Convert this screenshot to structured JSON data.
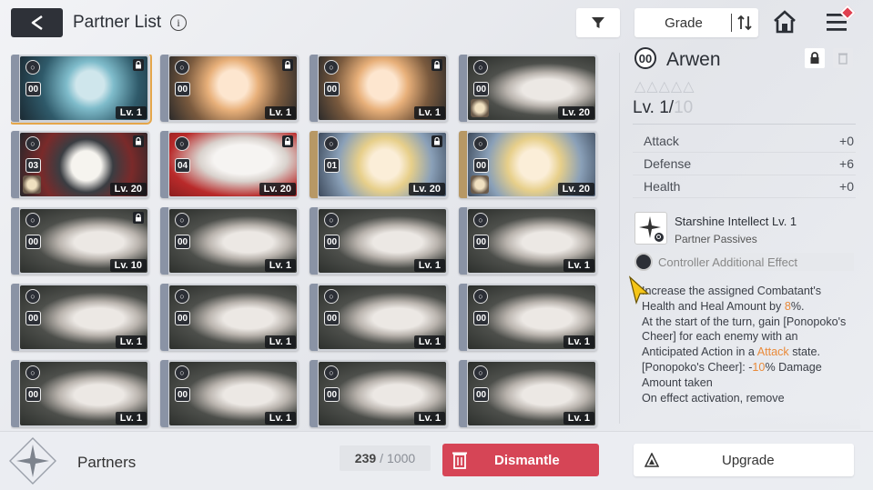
{
  "header": {
    "title": "Partner List",
    "info_glyph": "i",
    "grade_label": "Grade",
    "icons": [
      "back-arrow-icon",
      "info-icon",
      "filter-icon",
      "sort-icon",
      "home-icon",
      "menu-icon"
    ]
  },
  "partners": [
    {
      "num": "00",
      "level": "Lv. 1",
      "locked": true,
      "selected": true,
      "art": "teal"
    },
    {
      "num": "00",
      "level": "Lv. 1",
      "locked": true,
      "art": "orange"
    },
    {
      "num": "00",
      "level": "Lv. 1",
      "locked": true,
      "art": "orange"
    },
    {
      "num": "00",
      "level": "Lv. 20",
      "locked": false,
      "art": "mask",
      "mini": true
    },
    {
      "num": "03",
      "level": "Lv. 20",
      "locked": true,
      "art": "rabbit",
      "mini": true
    },
    {
      "num": "04",
      "level": "Lv. 20",
      "locked": true,
      "art": "white"
    },
    {
      "num": "01",
      "level": "Lv. 20",
      "locked": true,
      "art": "blonde",
      "gold": true
    },
    {
      "num": "00",
      "level": "Lv. 20",
      "locked": false,
      "art": "blonde",
      "gold": true,
      "mini": true
    },
    {
      "num": "00",
      "level": "Lv. 10",
      "locked": true,
      "art": "mask"
    },
    {
      "num": "00",
      "level": "Lv. 1",
      "locked": false,
      "art": "mask"
    },
    {
      "num": "00",
      "level": "Lv. 1",
      "locked": false,
      "art": "mask"
    },
    {
      "num": "00",
      "level": "Lv. 1",
      "locked": false,
      "art": "mask"
    },
    {
      "num": "00",
      "level": "Lv. 1",
      "locked": false,
      "art": "mask"
    },
    {
      "num": "00",
      "level": "Lv. 1",
      "locked": false,
      "art": "mask"
    },
    {
      "num": "00",
      "level": "Lv. 1",
      "locked": false,
      "art": "mask"
    },
    {
      "num": "00",
      "level": "Lv. 1",
      "locked": false,
      "art": "mask"
    },
    {
      "num": "00",
      "level": "Lv. 1",
      "locked": false,
      "art": "mask"
    },
    {
      "num": "00",
      "level": "Lv. 1",
      "locked": false,
      "art": "mask"
    },
    {
      "num": "00",
      "level": "Lv. 1",
      "locked": false,
      "art": "mask"
    },
    {
      "num": "00",
      "level": "Lv. 1",
      "locked": false,
      "art": "mask"
    }
  ],
  "detail": {
    "num": "00",
    "name": "Arwen",
    "stars": "△△△△△",
    "level_current": "Lv. 1/",
    "level_max": "10",
    "stats": [
      {
        "label": "Attack",
        "value": "+0"
      },
      {
        "label": "Defense",
        "value": "+6"
      },
      {
        "label": "Health",
        "value": "+0"
      }
    ],
    "skill_name": "Starshine Intellect Lv. 1",
    "skill_sub": "Partner Passives",
    "controller_label": "Controller Additional Effect",
    "desc": {
      "p1a": "Increase the assigned Combatant's Health and Heal Amount by ",
      "p1b": "8",
      "p1c": "%.",
      "p2a": "At the start of the turn, gain [Ponopoko's Cheer] for each enemy with an Anticipated Action in a ",
      "p2b": "Attack",
      "p2c": " state.",
      "p3a": "[Ponopoko's Cheer]: -",
      "p3b": "10",
      "p3c": "% Damage Amount taken",
      "p4": "On effect activation, remove"
    }
  },
  "bottom": {
    "partners_label": "Partners",
    "count_current": "239",
    "count_sep": "/",
    "count_max": "1000",
    "dismantle_label": "Dismantle",
    "upgrade_label": "Upgrade"
  },
  "colors": {
    "accent_red": "#d64556",
    "highlight": "#e98a3a",
    "selected_border": "#e5a64a",
    "dark": "#2c2f36"
  }
}
